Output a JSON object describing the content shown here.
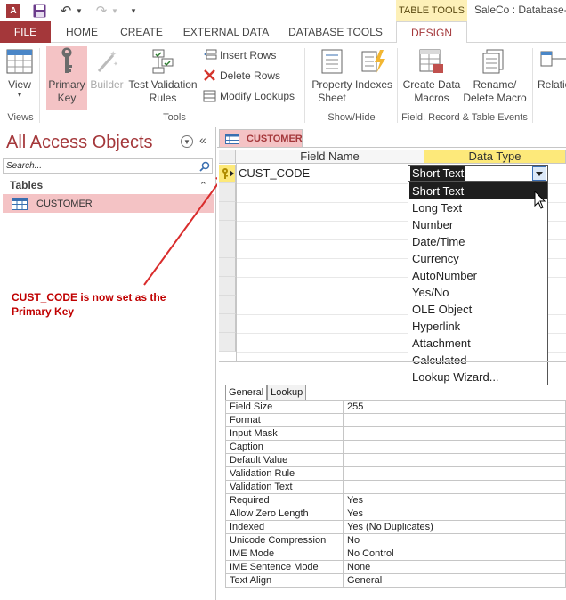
{
  "titlebar": {
    "app_icon": "access-logo-icon",
    "app_icon_letter": "A",
    "contextual_group": "TABLE TOOLS",
    "window_title": "SaleCo : Database-"
  },
  "tabs": [
    {
      "label": "FILE"
    },
    {
      "label": "HOME"
    },
    {
      "label": "CREATE"
    },
    {
      "label": "EXTERNAL DATA"
    },
    {
      "label": "DATABASE TOOLS"
    },
    {
      "label": "DESIGN"
    }
  ],
  "ribbon": {
    "view": "View",
    "primary_key": "Primary\nKey",
    "builder": "Builder",
    "test_rules": "Test Validation\nRules",
    "insert_rows": "Insert Rows",
    "delete_rows": "Delete Rows",
    "modify_lookups": "Modify Lookups",
    "property_sheet": "Property\nSheet",
    "indexes": "Indexes",
    "create_data_macros": "Create Data\nMacros",
    "rename_delete_macro": "Rename/\nDelete Macro",
    "relationships": "Relatio",
    "groups": {
      "views": "Views",
      "tools": "Tools",
      "show_hide": "Show/Hide",
      "events": "Field, Record & Table Events"
    },
    "colors": {
      "accent": "#a4373a",
      "active_bg": "#f4c3c5"
    }
  },
  "nav": {
    "title": "All Access Objects",
    "search_placeholder": "Search...",
    "group": "Tables",
    "items": [
      {
        "label": "CUSTOMER"
      }
    ]
  },
  "annotation": {
    "text": "CUST_CODE is now set as the Primary Key",
    "color": "#c00000"
  },
  "document": {
    "tab": "CUSTOMER",
    "headers": {
      "field_name": "Field Name",
      "data_type": "Data Type"
    },
    "rows": [
      {
        "field_name": "CUST_CODE",
        "data_type": "Short Text",
        "primary_key": true
      }
    ],
    "data_type_options": [
      "Short Text",
      "Long Text",
      "Number",
      "Date/Time",
      "Currency",
      "AutoNumber",
      "Yes/No",
      "OLE Object",
      "Hyperlink",
      "Attachment",
      "Calculated",
      "Lookup Wizard..."
    ],
    "selected_option": "Short Text"
  },
  "properties": {
    "tabs": [
      "General",
      "Lookup"
    ],
    "rows": [
      {
        "k": "Field Size",
        "v": "255"
      },
      {
        "k": "Format",
        "v": ""
      },
      {
        "k": "Input Mask",
        "v": ""
      },
      {
        "k": "Caption",
        "v": ""
      },
      {
        "k": "Default Value",
        "v": ""
      },
      {
        "k": "Validation Rule",
        "v": ""
      },
      {
        "k": "Validation Text",
        "v": ""
      },
      {
        "k": "Required",
        "v": "Yes"
      },
      {
        "k": "Allow Zero Length",
        "v": "Yes"
      },
      {
        "k": "Indexed",
        "v": "Yes (No Duplicates)"
      },
      {
        "k": "Unicode Compression",
        "v": "No"
      },
      {
        "k": "IME Mode",
        "v": "No Control"
      },
      {
        "k": "IME Sentence Mode",
        "v": "None"
      },
      {
        "k": "Text Align",
        "v": "General"
      }
    ]
  }
}
